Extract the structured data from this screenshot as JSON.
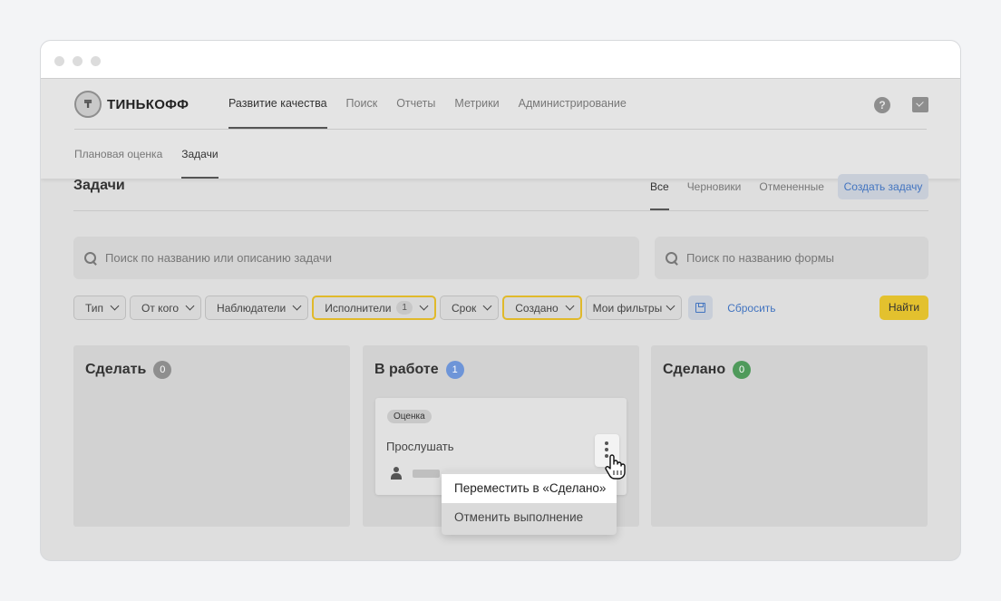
{
  "logo": {
    "text": "ТИНЬКОФФ"
  },
  "top_nav": [
    {
      "label": "Развитие качества",
      "active": true
    },
    {
      "label": "Поиск",
      "active": false
    },
    {
      "label": "Отчеты",
      "active": false
    },
    {
      "label": "Метрики",
      "active": false
    },
    {
      "label": "Администрирование",
      "active": false
    }
  ],
  "header_icons": {
    "help": "?",
    "help_icon": "help-circle-icon",
    "inbox_icon": "inbox-icon"
  },
  "sub_nav": [
    {
      "label": "Плановая оценка",
      "active": false
    },
    {
      "label": "Задачи",
      "active": true
    }
  ],
  "page": {
    "title": "Задачи",
    "tabs": [
      {
        "label": "Все",
        "active": true
      },
      {
        "label": "Черновики",
        "active": false
      },
      {
        "label": "Отмененные",
        "active": false
      }
    ],
    "create_button": "Создать задачу"
  },
  "search": {
    "tasks_placeholder": "Поиск по названию или описанию задачи",
    "forms_placeholder": "Поиск по названию формы"
  },
  "filters": {
    "type": "Тип",
    "from": "От кого",
    "observers": "Наблюдатели",
    "executors": "Исполнители",
    "executors_count": "1",
    "deadline": "Срок",
    "created": "Создано",
    "my_filters": "Мои фильтры",
    "reset": "Сбросить",
    "find": "Найти"
  },
  "columns": [
    {
      "title": "Сделать",
      "count": "0",
      "badge_color": "#8e8e8e"
    },
    {
      "title": "В работе",
      "count": "1",
      "badge_color": "#6e95d8"
    },
    {
      "title": "Сделано",
      "count": "0",
      "badge_color": "#4f9a5b"
    }
  ],
  "task_card": {
    "tag": "Оценка",
    "title": "Прослушать"
  },
  "context_menu": {
    "move_done": "Переместить в «Сделано»",
    "cancel": "Отменить выполнение"
  },
  "colors": {
    "accent_yellow": "#e3c12e",
    "link_blue": "#4274c0"
  }
}
